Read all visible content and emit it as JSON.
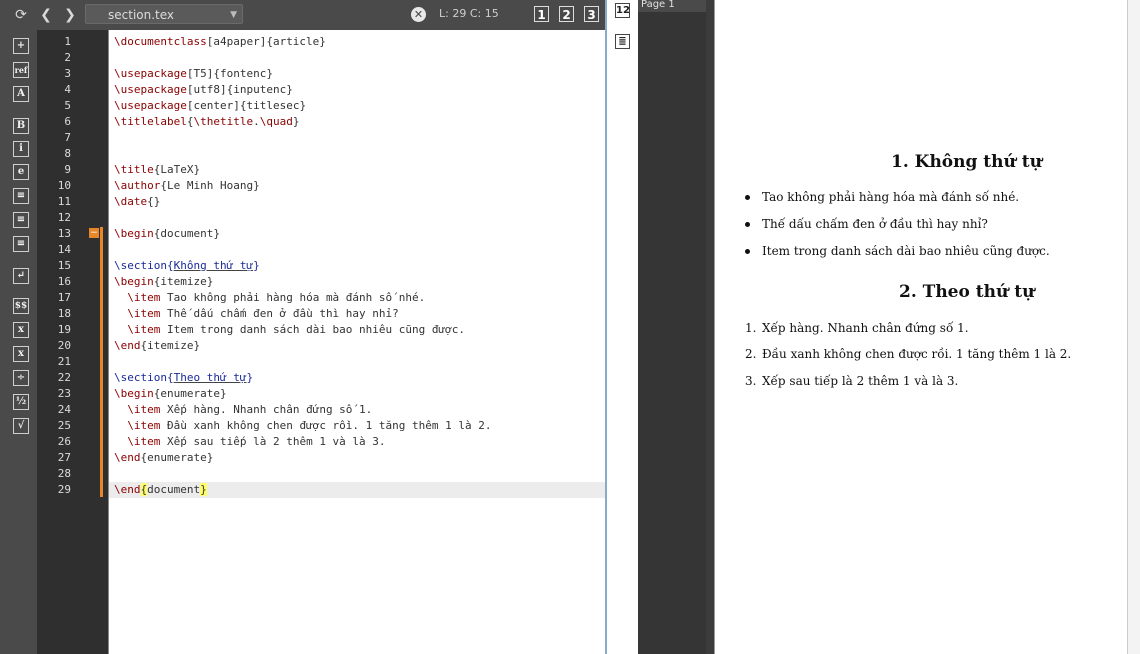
{
  "toolbar": {
    "file_name": "section.tex",
    "cursor_position": "L: 29 C: 15",
    "view_buttons": [
      "1",
      "2",
      "3"
    ],
    "close_symbol": "✕"
  },
  "palette": {
    "items": [
      {
        "icon": "insert-block-icon",
        "glyph": "+"
      },
      {
        "icon": "ref-icon",
        "glyph": "ref"
      },
      {
        "icon": "font-size-icon",
        "glyph": "A"
      },
      {
        "icon": "bold-icon",
        "glyph": "B"
      },
      {
        "icon": "italic-icon",
        "glyph": "i"
      },
      {
        "icon": "emphasis-icon",
        "glyph": "e"
      },
      {
        "icon": "align-left-icon",
        "glyph": "≡"
      },
      {
        "icon": "align-center-icon",
        "glyph": "≡"
      },
      {
        "icon": "align-right-icon",
        "glyph": "≡"
      },
      {
        "icon": "newline-icon",
        "glyph": "↵"
      },
      {
        "icon": "math-icon",
        "glyph": "$$"
      },
      {
        "icon": "subscript-icon",
        "glyph": "x"
      },
      {
        "icon": "superscript-icon",
        "glyph": "x"
      },
      {
        "icon": "division-icon",
        "glyph": "÷"
      },
      {
        "icon": "fraction-icon",
        "glyph": "½"
      },
      {
        "icon": "sqrt-icon",
        "glyph": "√"
      }
    ]
  },
  "editor": {
    "current_line": 29,
    "lines": [
      "\\documentclass[a4paper]{article}",
      "",
      "\\usepackage[T5]{fontenc}",
      "\\usepackage[utf8]{inputenc}",
      "\\usepackage[center]{titlesec}",
      "\\titlelabel{\\thetitle.\\quad}",
      "",
      "",
      "\\title{LaTeX}",
      "\\author{Le Minh Hoang}",
      "\\date{}",
      "",
      "\\begin{document}",
      "",
      "\\section{Không thứ tự}",
      "\\begin{itemize}",
      "  \\item Tao không phải hàng hóa mà đánh số nhé.",
      "  \\item Thế dấu chấm đen ở đầu thì hay nhỉ?",
      "  \\item Item trong danh sách dài bao nhiêu cũng được.",
      "\\end{itemize}",
      "",
      "\\section{Theo thứ tự}",
      "\\begin{enumerate}",
      "  \\item Xếp hàng. Nhanh chân đứng số 1.",
      "  \\item Đầu xanh không chen được rồi. 1 tăng thêm 1 là 2.",
      "  \\item Xếp sau tiếp là 2 thêm 1 và là 3.",
      "\\end{enumerate}",
      "",
      "\\end{document}"
    ]
  },
  "side_panel": {
    "icons": [
      "12",
      "≣"
    ]
  },
  "viewer": {
    "page_label": "Page 1",
    "section1_title": "1.    Không thứ tự",
    "section1_items": [
      "Tao không phải hàng hóa mà đánh số nhé.",
      "Thế dấu chấm đen ở đầu thì hay nhỉ?",
      "Item trong danh sách dài bao nhiêu cũng được."
    ],
    "section2_title": "2.    Theo thứ tự",
    "section2_items": [
      {
        "num": "1.",
        "text": "Xếp hàng. Nhanh chân đứng số 1."
      },
      {
        "num": "2.",
        "text": "Đầu xanh không chen được rồi. 1 tăng thêm 1 là 2."
      },
      {
        "num": "3.",
        "text": "Xếp sau tiếp là 2 thêm 1 và là 3."
      }
    ]
  }
}
